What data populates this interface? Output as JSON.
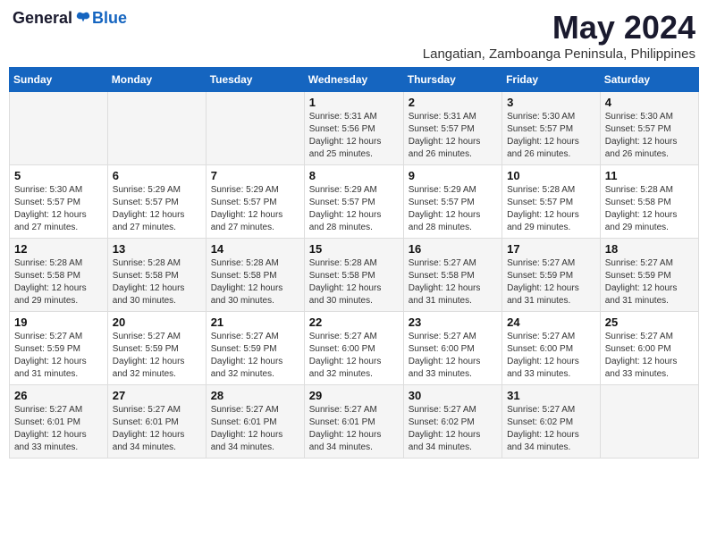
{
  "logo": {
    "general": "General",
    "blue": "Blue"
  },
  "title": "May 2024",
  "location": "Langatian, Zamboanga Peninsula, Philippines",
  "weekdays": [
    "Sunday",
    "Monday",
    "Tuesday",
    "Wednesday",
    "Thursday",
    "Friday",
    "Saturday"
  ],
  "weeks": [
    [
      {
        "day": "",
        "sunrise": "",
        "sunset": "",
        "daylight": ""
      },
      {
        "day": "",
        "sunrise": "",
        "sunset": "",
        "daylight": ""
      },
      {
        "day": "",
        "sunrise": "",
        "sunset": "",
        "daylight": ""
      },
      {
        "day": "1",
        "sunrise": "Sunrise: 5:31 AM",
        "sunset": "Sunset: 5:56 PM",
        "daylight": "Daylight: 12 hours and 25 minutes."
      },
      {
        "day": "2",
        "sunrise": "Sunrise: 5:31 AM",
        "sunset": "Sunset: 5:57 PM",
        "daylight": "Daylight: 12 hours and 26 minutes."
      },
      {
        "day": "3",
        "sunrise": "Sunrise: 5:30 AM",
        "sunset": "Sunset: 5:57 PM",
        "daylight": "Daylight: 12 hours and 26 minutes."
      },
      {
        "day": "4",
        "sunrise": "Sunrise: 5:30 AM",
        "sunset": "Sunset: 5:57 PM",
        "daylight": "Daylight: 12 hours and 26 minutes."
      }
    ],
    [
      {
        "day": "5",
        "sunrise": "Sunrise: 5:30 AM",
        "sunset": "Sunset: 5:57 PM",
        "daylight": "Daylight: 12 hours and 27 minutes."
      },
      {
        "day": "6",
        "sunrise": "Sunrise: 5:29 AM",
        "sunset": "Sunset: 5:57 PM",
        "daylight": "Daylight: 12 hours and 27 minutes."
      },
      {
        "day": "7",
        "sunrise": "Sunrise: 5:29 AM",
        "sunset": "Sunset: 5:57 PM",
        "daylight": "Daylight: 12 hours and 27 minutes."
      },
      {
        "day": "8",
        "sunrise": "Sunrise: 5:29 AM",
        "sunset": "Sunset: 5:57 PM",
        "daylight": "Daylight: 12 hours and 28 minutes."
      },
      {
        "day": "9",
        "sunrise": "Sunrise: 5:29 AM",
        "sunset": "Sunset: 5:57 PM",
        "daylight": "Daylight: 12 hours and 28 minutes."
      },
      {
        "day": "10",
        "sunrise": "Sunrise: 5:28 AM",
        "sunset": "Sunset: 5:57 PM",
        "daylight": "Daylight: 12 hours and 29 minutes."
      },
      {
        "day": "11",
        "sunrise": "Sunrise: 5:28 AM",
        "sunset": "Sunset: 5:58 PM",
        "daylight": "Daylight: 12 hours and 29 minutes."
      }
    ],
    [
      {
        "day": "12",
        "sunrise": "Sunrise: 5:28 AM",
        "sunset": "Sunset: 5:58 PM",
        "daylight": "Daylight: 12 hours and 29 minutes."
      },
      {
        "day": "13",
        "sunrise": "Sunrise: 5:28 AM",
        "sunset": "Sunset: 5:58 PM",
        "daylight": "Daylight: 12 hours and 30 minutes."
      },
      {
        "day": "14",
        "sunrise": "Sunrise: 5:28 AM",
        "sunset": "Sunset: 5:58 PM",
        "daylight": "Daylight: 12 hours and 30 minutes."
      },
      {
        "day": "15",
        "sunrise": "Sunrise: 5:28 AM",
        "sunset": "Sunset: 5:58 PM",
        "daylight": "Daylight: 12 hours and 30 minutes."
      },
      {
        "day": "16",
        "sunrise": "Sunrise: 5:27 AM",
        "sunset": "Sunset: 5:58 PM",
        "daylight": "Daylight: 12 hours and 31 minutes."
      },
      {
        "day": "17",
        "sunrise": "Sunrise: 5:27 AM",
        "sunset": "Sunset: 5:59 PM",
        "daylight": "Daylight: 12 hours and 31 minutes."
      },
      {
        "day": "18",
        "sunrise": "Sunrise: 5:27 AM",
        "sunset": "Sunset: 5:59 PM",
        "daylight": "Daylight: 12 hours and 31 minutes."
      }
    ],
    [
      {
        "day": "19",
        "sunrise": "Sunrise: 5:27 AM",
        "sunset": "Sunset: 5:59 PM",
        "daylight": "Daylight: 12 hours and 31 minutes."
      },
      {
        "day": "20",
        "sunrise": "Sunrise: 5:27 AM",
        "sunset": "Sunset: 5:59 PM",
        "daylight": "Daylight: 12 hours and 32 minutes."
      },
      {
        "day": "21",
        "sunrise": "Sunrise: 5:27 AM",
        "sunset": "Sunset: 5:59 PM",
        "daylight": "Daylight: 12 hours and 32 minutes."
      },
      {
        "day": "22",
        "sunrise": "Sunrise: 5:27 AM",
        "sunset": "Sunset: 6:00 PM",
        "daylight": "Daylight: 12 hours and 32 minutes."
      },
      {
        "day": "23",
        "sunrise": "Sunrise: 5:27 AM",
        "sunset": "Sunset: 6:00 PM",
        "daylight": "Daylight: 12 hours and 33 minutes."
      },
      {
        "day": "24",
        "sunrise": "Sunrise: 5:27 AM",
        "sunset": "Sunset: 6:00 PM",
        "daylight": "Daylight: 12 hours and 33 minutes."
      },
      {
        "day": "25",
        "sunrise": "Sunrise: 5:27 AM",
        "sunset": "Sunset: 6:00 PM",
        "daylight": "Daylight: 12 hours and 33 minutes."
      }
    ],
    [
      {
        "day": "26",
        "sunrise": "Sunrise: 5:27 AM",
        "sunset": "Sunset: 6:01 PM",
        "daylight": "Daylight: 12 hours and 33 minutes."
      },
      {
        "day": "27",
        "sunrise": "Sunrise: 5:27 AM",
        "sunset": "Sunset: 6:01 PM",
        "daylight": "Daylight: 12 hours and 34 minutes."
      },
      {
        "day": "28",
        "sunrise": "Sunrise: 5:27 AM",
        "sunset": "Sunset: 6:01 PM",
        "daylight": "Daylight: 12 hours and 34 minutes."
      },
      {
        "day": "29",
        "sunrise": "Sunrise: 5:27 AM",
        "sunset": "Sunset: 6:01 PM",
        "daylight": "Daylight: 12 hours and 34 minutes."
      },
      {
        "day": "30",
        "sunrise": "Sunrise: 5:27 AM",
        "sunset": "Sunset: 6:02 PM",
        "daylight": "Daylight: 12 hours and 34 minutes."
      },
      {
        "day": "31",
        "sunrise": "Sunrise: 5:27 AM",
        "sunset": "Sunset: 6:02 PM",
        "daylight": "Daylight: 12 hours and 34 minutes."
      },
      {
        "day": "",
        "sunrise": "",
        "sunset": "",
        "daylight": ""
      }
    ]
  ]
}
